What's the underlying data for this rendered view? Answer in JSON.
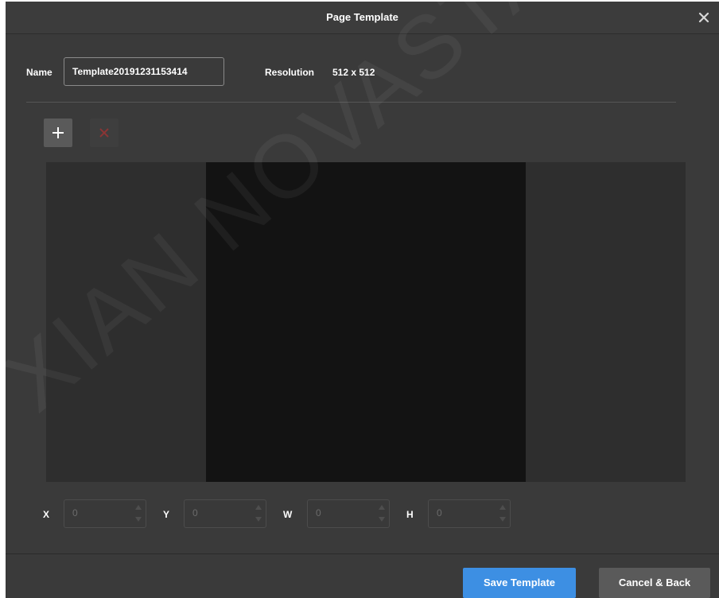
{
  "window": {
    "title": "Page Template",
    "close_icon": "close-icon"
  },
  "form": {
    "name_label": "Name",
    "name_value": "Template20191231153414",
    "resolution_label": "Resolution",
    "resolution_value": "512 x 512"
  },
  "toolbar": {
    "add_icon": "plus-icon",
    "delete_icon": "delete-x-icon"
  },
  "watermark": {
    "text": "XIAN NOVASTAR TE"
  },
  "coords": {
    "x_label": "X",
    "x_value": "0",
    "y_label": "Y",
    "y_value": "0",
    "w_label": "W",
    "w_value": "0",
    "h_label": "H",
    "h_value": "0"
  },
  "footer": {
    "save_label": "Save Template",
    "cancel_label": "Cancel & Back"
  },
  "colors": {
    "accent": "#3d8fe3",
    "dialog_bg": "#3a3a3a",
    "canvas_bg": "#2e2e2e",
    "page_bg": "#131313",
    "delete_icon": "#8b3535"
  }
}
